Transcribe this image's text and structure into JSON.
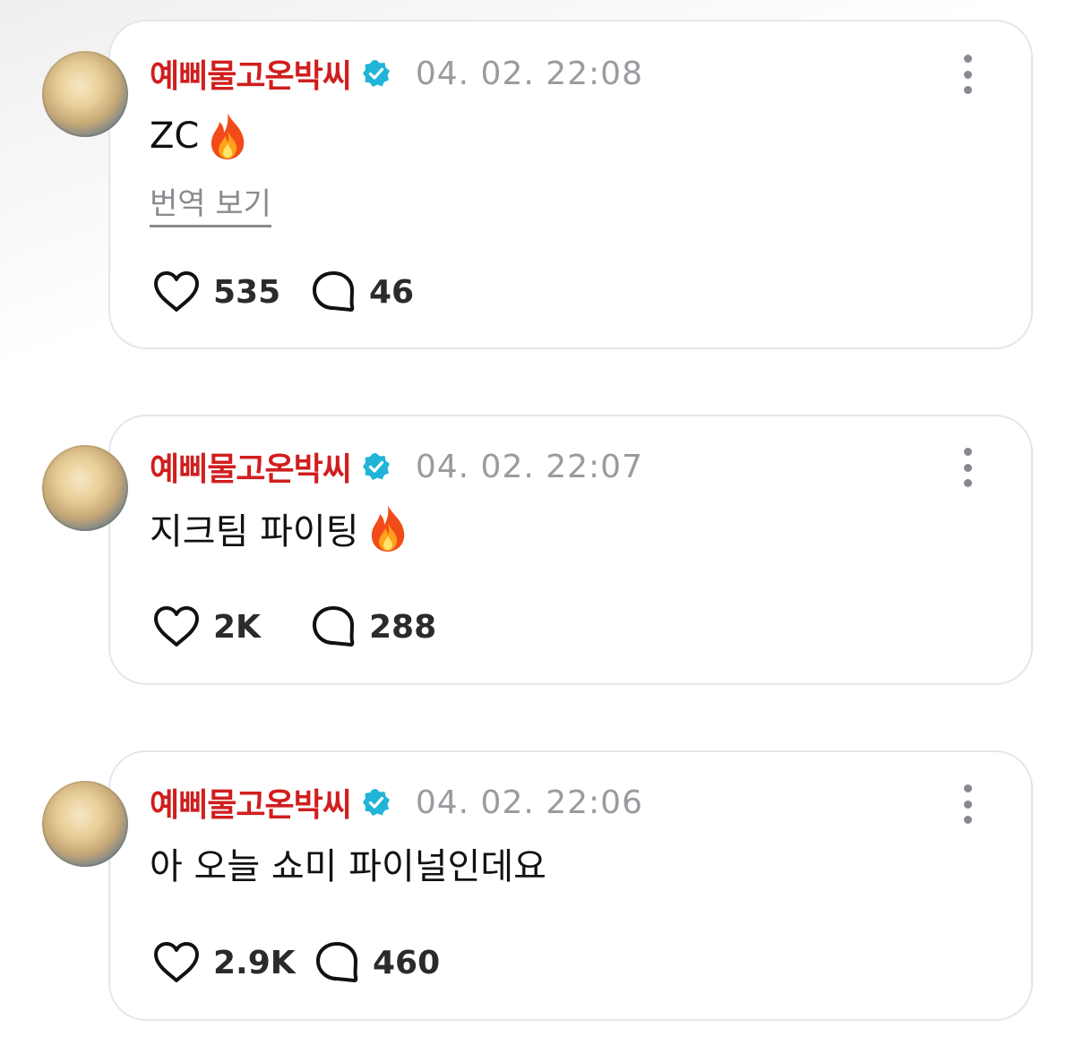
{
  "posts": [
    {
      "username": "예삐물고온박씨",
      "timestamp": "04. 02. 22:08",
      "content": "ZC",
      "has_fire_emoji": true,
      "translate_label": "번역 보기",
      "likes": "535",
      "comments": "46"
    },
    {
      "username": "예삐물고온박씨",
      "timestamp": "04. 02. 22:07",
      "content": "지크팀 파이팅",
      "has_fire_emoji": true,
      "likes": "2K",
      "comments": "288"
    },
    {
      "username": "예삐물고온박씨",
      "timestamp": "04. 02. 22:06",
      "content": "아 오늘 쇼미 파이널인데요",
      "has_fire_emoji": false,
      "likes": "2.9K",
      "comments": "460"
    }
  ],
  "icons": {
    "verified": "verified-badge-icon",
    "like": "heart-icon",
    "comment": "comment-bubble-icon",
    "more": "more-vertical-icon",
    "fire": "fire-emoji"
  },
  "colors": {
    "username": "#d01e1e",
    "verified_badge": "#1fb4d8",
    "timestamp": "#9a9aa0",
    "card_border": "#e6e6ea"
  }
}
